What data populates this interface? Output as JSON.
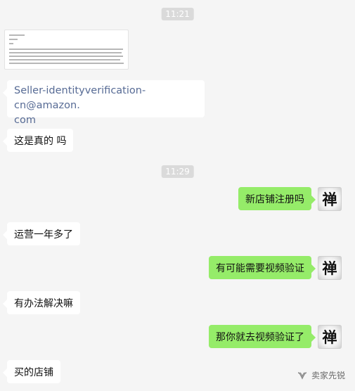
{
  "timestamps": [
    "11:21",
    "11:29"
  ],
  "messages": {
    "email": "Seller-identityverification-cn@amazon.com",
    "email_line1": "Seller-identityverification-cn@amazon.",
    "email_line2": "com",
    "is_real": "这是真的 吗",
    "new_store": "新店铺注册吗",
    "operating": "运营一年多了",
    "video_maybe": "有可能需要视频验证",
    "any_solution": "有办法解决嘛",
    "go_video": "那你就去视频验证了",
    "bought_store": "买的店铺"
  },
  "avatar_glyph": "禅",
  "watermark": {
    "text": "卖家先锐",
    "icon": "wechat-channel-icon"
  },
  "colors": {
    "background": "#f5f5f5",
    "outgoing_bubble": "#95ec69",
    "incoming_bubble": "#ffffff",
    "link": "#576b95",
    "timestamp_bg": "#dadada"
  }
}
